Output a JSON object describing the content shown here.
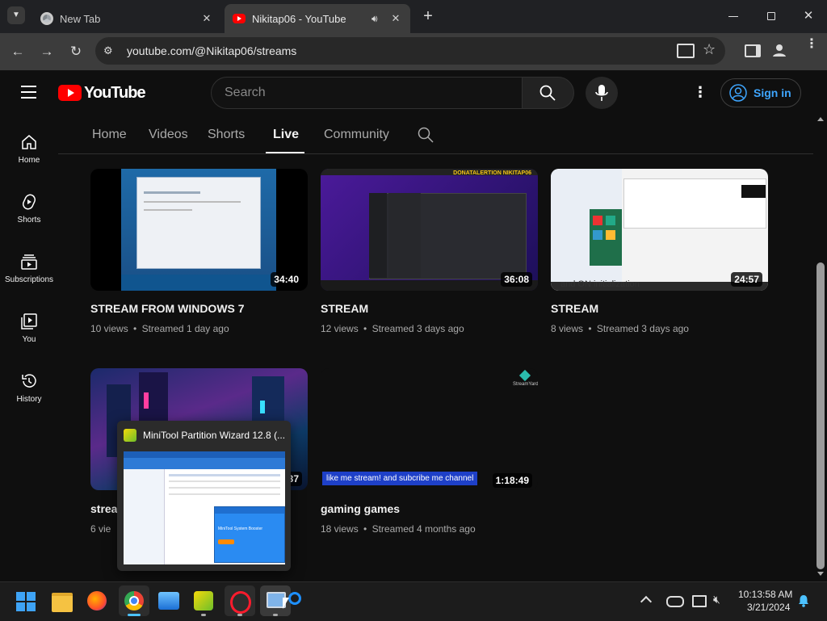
{
  "browser": {
    "tabs": [
      {
        "title": "New Tab"
      },
      {
        "title": "Nikitap06 - YouTube"
      }
    ],
    "url": "youtube.com/@Nikitap06/streams"
  },
  "masthead": {
    "logo_text": "YouTube",
    "search_placeholder": "Search",
    "signin_label": "Sign in"
  },
  "guide": [
    {
      "label": "Home",
      "icon": "home-icon"
    },
    {
      "label": "Shorts",
      "icon": "shorts-icon"
    },
    {
      "label": "Subscriptions",
      "icon": "subscriptions-icon"
    },
    {
      "label": "You",
      "icon": "you-icon"
    },
    {
      "label": "History",
      "icon": "history-icon"
    }
  ],
  "channel_tabs": [
    {
      "label": "Home"
    },
    {
      "label": "Videos"
    },
    {
      "label": "Shorts"
    },
    {
      "label": "Live",
      "selected": true
    },
    {
      "label": "Community"
    }
  ],
  "videos": [
    {
      "title": "STREAM FROM WINDOWS 7",
      "views": "10 views",
      "when": "Streamed 1 day ago",
      "duration": "34:40"
    },
    {
      "title": "STREAM",
      "views": "12 views",
      "when": "Streamed 3 days ago",
      "duration": "36:08",
      "overlay": "DONATALERTION NIKITAP06"
    },
    {
      "title": "STREAM",
      "views": "8 views",
      "when": "Streamed 3 days ago",
      "duration": "24:57",
      "overlay": "and ON initialization"
    },
    {
      "title": "strea",
      "views": "6 vie",
      "when": "",
      "duration": "37"
    },
    {
      "title": "gaming games",
      "views": "18 views",
      "when": "Streamed 4 months ago",
      "duration": "1:18:49",
      "banner": "like me stream! and subcribe me channel",
      "badge": "StreamYard"
    }
  ],
  "meta_separator": "•",
  "taskbar_preview": {
    "title": "MiniTool Partition Wizard 12.8 (...",
    "ad_title": "MiniTool System Booster"
  },
  "tray": {
    "time": "10:13:58 AM",
    "date": "3/21/2024"
  },
  "colors": {
    "youtube_red": "#ff0000",
    "link_blue": "#3ea6ff",
    "background": "#0f0f0f"
  }
}
